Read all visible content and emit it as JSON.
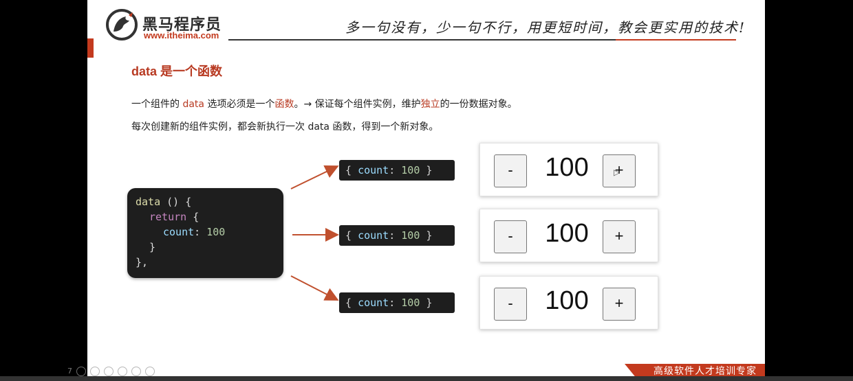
{
  "header": {
    "brand_name": "黑马程序员",
    "brand_url": "www.itheima.com",
    "slogan": "多一句没有，少一句不行，用更短时间，教会更实用的技术!"
  },
  "content": {
    "title": "data 是一个函数",
    "line1": {
      "p1": "一个组件的 ",
      "h1": "data",
      "p2": " 选项必须是一个",
      "h2": "函数",
      "p3": "。→  保证每个组件实例，维护",
      "h3": "独立",
      "p4": "的一份数据对象。"
    },
    "line2": "每次创建新的组件实例，都会新执行一次 data 函数，得到一个新对象。"
  },
  "code": {
    "l1_fn": "data",
    "l1_rest": " () {",
    "l2_kw": "return",
    "l2_rest": " {",
    "l3_prop": "count",
    "l3_colon": ": ",
    "l3_num": "100",
    "l4": "}",
    "l5": "},"
  },
  "objects": [
    {
      "open": "{ ",
      "prop": "count",
      "colon": ": ",
      "num": "100",
      "close": " }"
    },
    {
      "open": "{ ",
      "prop": "count",
      "colon": ": ",
      "num": "100",
      "close": " }"
    },
    {
      "open": "{ ",
      "prop": "count",
      "colon": ": ",
      "num": "100",
      "close": " }"
    }
  ],
  "counters": [
    {
      "minus": "-",
      "value": "100",
      "plus": "+"
    },
    {
      "minus": "-",
      "value": "100",
      "plus": "+"
    },
    {
      "minus": "-",
      "value": "100",
      "plus": "+"
    }
  ],
  "footer": {
    "banner": "高级软件人才培训专家",
    "page_indicator": "7"
  },
  "colors": {
    "accent": "#c33a1e",
    "code_bg": "#1e1e1e"
  }
}
